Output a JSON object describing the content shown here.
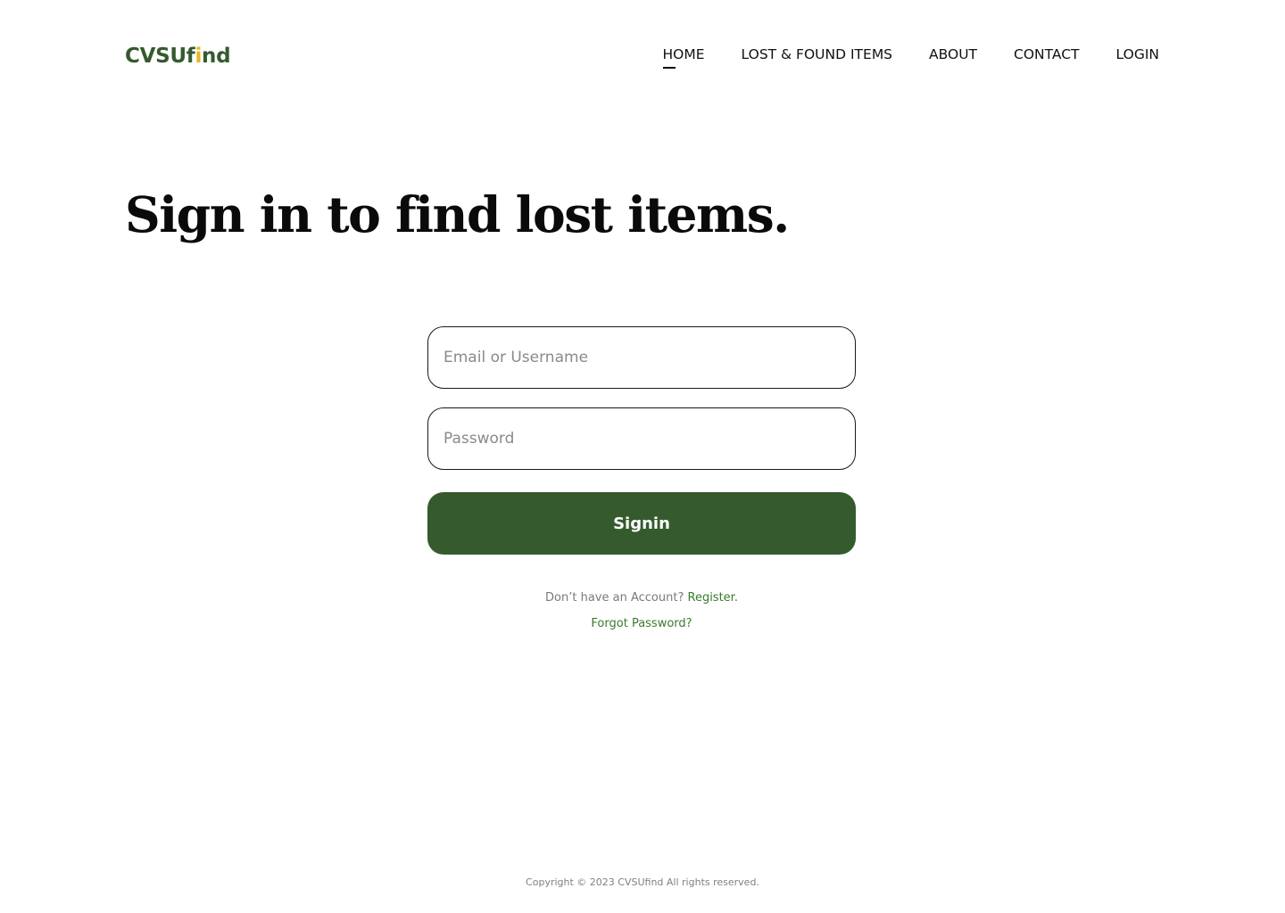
{
  "header": {
    "logo": {
      "part1": "CVSUf",
      "accent": "i",
      "part2": "nd"
    },
    "nav": {
      "home": "HOME",
      "lost_found": "LOST & FOUND ITEMS",
      "about": "ABOUT",
      "contact": "CONTACT",
      "login": "LOGIN"
    },
    "active_nav": "HOME"
  },
  "main": {
    "headline": "Sign in to find lost items."
  },
  "form": {
    "email_placeholder": "Email or Username",
    "email_value": "",
    "password_placeholder": "Password",
    "password_value": "",
    "signin_label": "Signin",
    "no_account_text": "Don’t have an Account?",
    "register_link": "Register.",
    "forgot_link": "Forgot Password?"
  },
  "footer": {
    "copyright": "Copyright © 2023 CVSUfind All rights reserved."
  },
  "colors": {
    "brand_green": "#355a2e",
    "logo_accent": "#e9b51f",
    "link_green": "#3a7a2e"
  }
}
